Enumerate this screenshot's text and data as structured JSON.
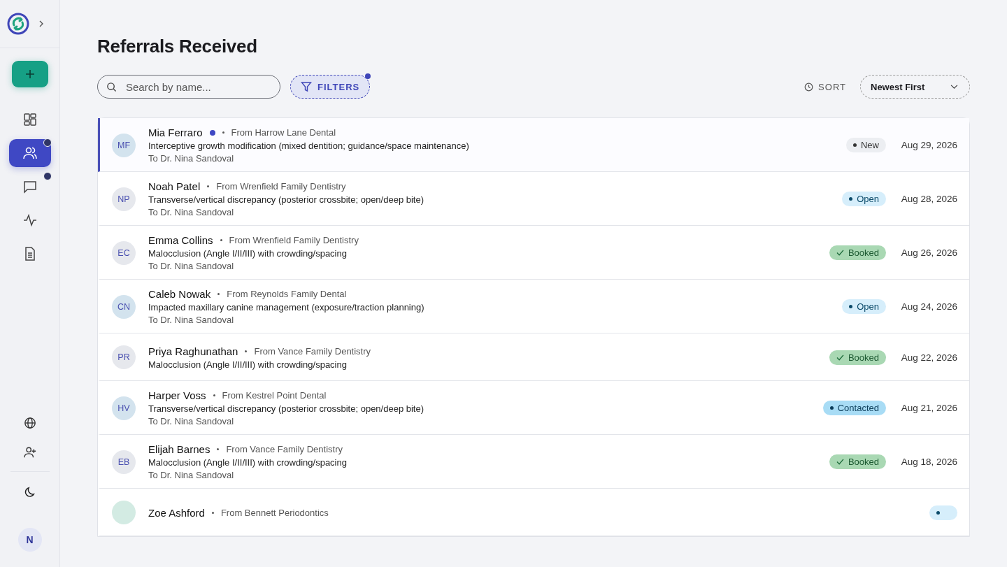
{
  "sidebar": {
    "nav": [
      {
        "kind": "dashboard",
        "selected": false,
        "badge": false
      },
      {
        "kind": "people",
        "selected": true,
        "badge": true
      },
      {
        "kind": "messages",
        "selected": false,
        "badge": true
      },
      {
        "kind": "activity",
        "selected": false,
        "badge": false
      },
      {
        "kind": "document",
        "selected": false,
        "badge": false
      }
    ],
    "bottom": [
      {
        "kind": "globe"
      },
      {
        "kind": "add-user"
      }
    ],
    "user": {
      "initial": "N"
    }
  },
  "title": "Referrals Received",
  "search": {
    "placeholder": "Search by name..."
  },
  "filters": {
    "label": "FILTERS",
    "active": true
  },
  "sort": {
    "label": "SORT",
    "value": "Newest First"
  },
  "referrals": [
    {
      "initials": "MF",
      "color": "#d3e3ee",
      "name": "Mia Ferraro",
      "unread": true,
      "selected": true,
      "from": "From Harrow Lane Dental",
      "reason": "Interceptive growth modification (mixed dentition; guidance/space maintenance)",
      "to": "To Dr. Nina Sandoval",
      "status": {
        "kind": "new",
        "label": "New"
      },
      "date": "Aug 29, 2026"
    },
    {
      "initials": "NP",
      "color": "#e6e8ed",
      "name": "Noah Patel",
      "unread": false,
      "selected": false,
      "from": "From Wrenfield Family Dentistry",
      "reason": "Transverse/vertical discrepancy (posterior crossbite; open/deep bite)",
      "to": "To Dr. Nina Sandoval",
      "status": {
        "kind": "open",
        "label": "Open"
      },
      "date": "Aug 28, 2026"
    },
    {
      "initials": "EC",
      "color": "#e6e8ed",
      "name": "Emma Collins",
      "unread": false,
      "selected": false,
      "from": "From Wrenfield Family Dentistry",
      "reason": "Malocclusion (Angle I/II/III) with crowding/spacing",
      "to": "To Dr. Nina Sandoval",
      "status": {
        "kind": "booked",
        "label": "Booked"
      },
      "date": "Aug 26, 2026"
    },
    {
      "initials": "CN",
      "color": "#d3e3ee",
      "name": "Caleb Nowak",
      "unread": false,
      "selected": false,
      "from": "From Reynolds Family Dental",
      "reason": "Impacted maxillary canine management (exposure/traction planning)",
      "to": "To Dr. Nina Sandoval",
      "status": {
        "kind": "open",
        "label": "Open"
      },
      "date": "Aug 24, 2026"
    },
    {
      "initials": "PR",
      "color": "#e6e8ed",
      "name": "Priya Raghunathan",
      "unread": false,
      "selected": false,
      "from": "From Vance Family Dentistry",
      "reason": "Malocclusion (Angle I/II/III) with crowding/spacing",
      "status": {
        "kind": "booked",
        "label": "Booked"
      },
      "date": "Aug 22, 2026"
    },
    {
      "initials": "HV",
      "color": "#d3e3ee",
      "name": "Harper Voss",
      "unread": false,
      "selected": false,
      "from": "From Kestrel Point Dental",
      "reason": "Transverse/vertical discrepancy (posterior crossbite; open/deep bite)",
      "to": "To Dr. Nina Sandoval",
      "status": {
        "kind": "contacted",
        "label": "Contacted"
      },
      "date": "Aug 21, 2026"
    },
    {
      "initials": "EB",
      "color": "#e6e8ed",
      "name": "Elijah Barnes",
      "unread": false,
      "selected": false,
      "from": "From Vance Family Dentistry",
      "reason": "Malocclusion (Angle I/II/III) with crowding/spacing",
      "to": "To Dr. Nina Sandoval",
      "status": {
        "kind": "booked",
        "label": "Booked"
      },
      "date": "Aug 18, 2026"
    },
    {
      "color": "#d3ebe3",
      "name": "Zoe Ashford",
      "unread": false,
      "selected": false,
      "from": "From Bennett Periodontics",
      "status": {
        "kind": "open"
      }
    }
  ]
}
